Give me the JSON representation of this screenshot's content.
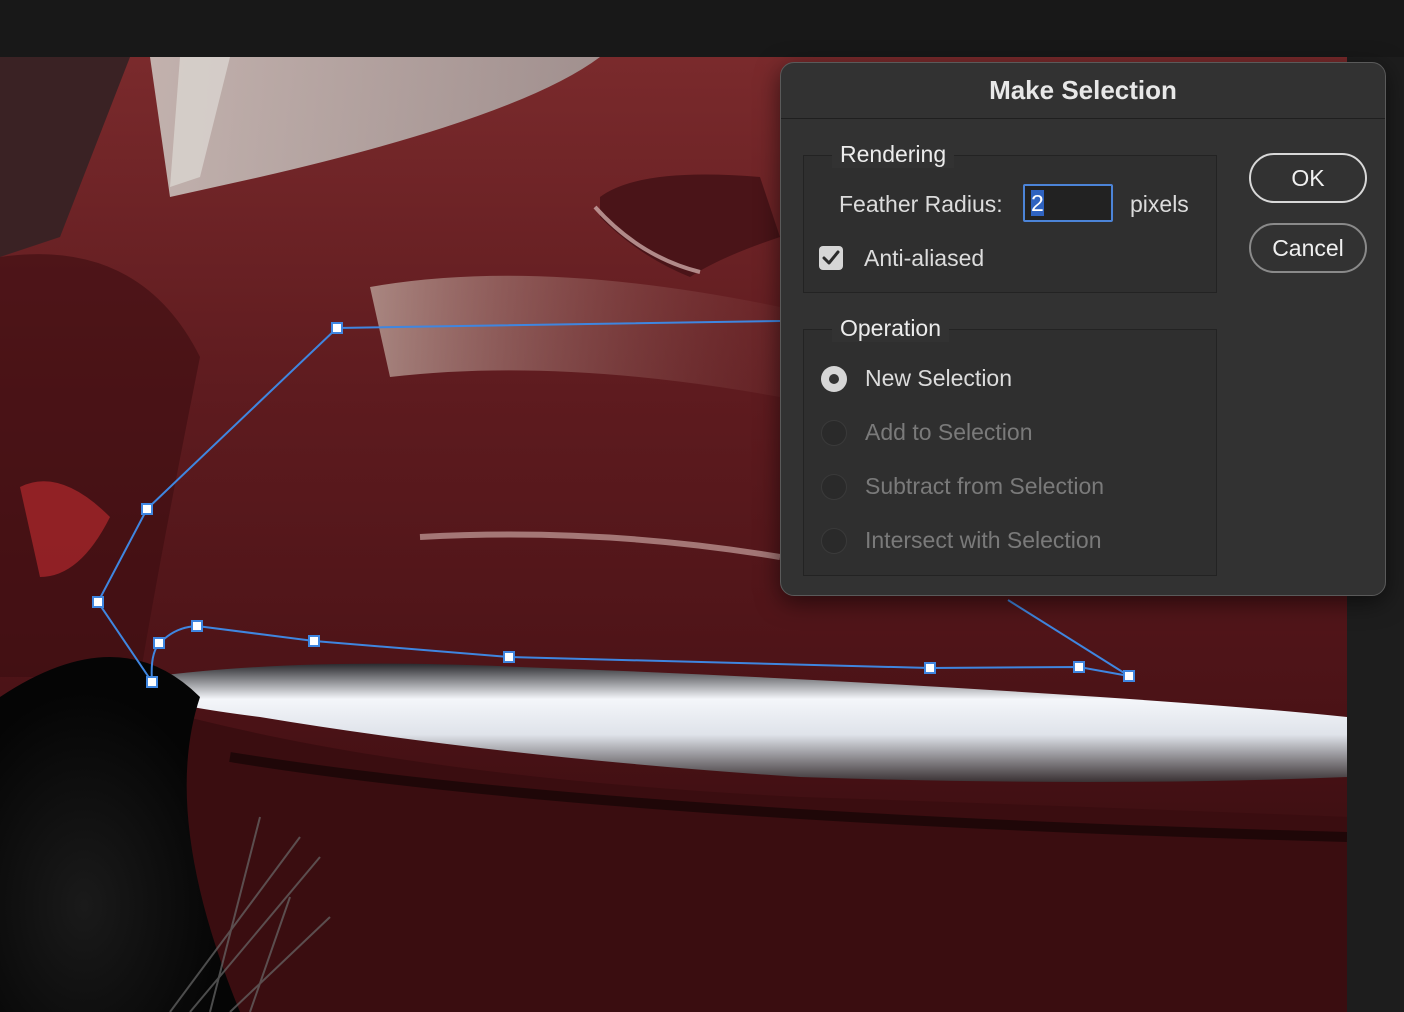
{
  "dialog": {
    "title": "Make Selection",
    "rendering": {
      "legend": "Rendering",
      "feather_label": "Feather Radius:",
      "feather_value": "2",
      "feather_unit": "pixels",
      "anti_aliased_label": "Anti-aliased",
      "anti_aliased_checked": true
    },
    "operation": {
      "legend": "Operation",
      "options": [
        {
          "label": "New Selection",
          "selected": true,
          "enabled": true
        },
        {
          "label": "Add to Selection",
          "selected": false,
          "enabled": false
        },
        {
          "label": "Subtract from Selection",
          "selected": false,
          "enabled": false
        },
        {
          "label": "Intersect with Selection",
          "selected": false,
          "enabled": false
        }
      ]
    },
    "buttons": {
      "ok": "OK",
      "cancel": "Cancel"
    }
  },
  "colors": {
    "path_stroke": "#3f86e0",
    "dialog_bg": "#323232",
    "car_paint": "#5a1418"
  },
  "icons": [
    "checkmark-icon",
    "radio-selected-icon",
    "radio-unselected-icon"
  ]
}
